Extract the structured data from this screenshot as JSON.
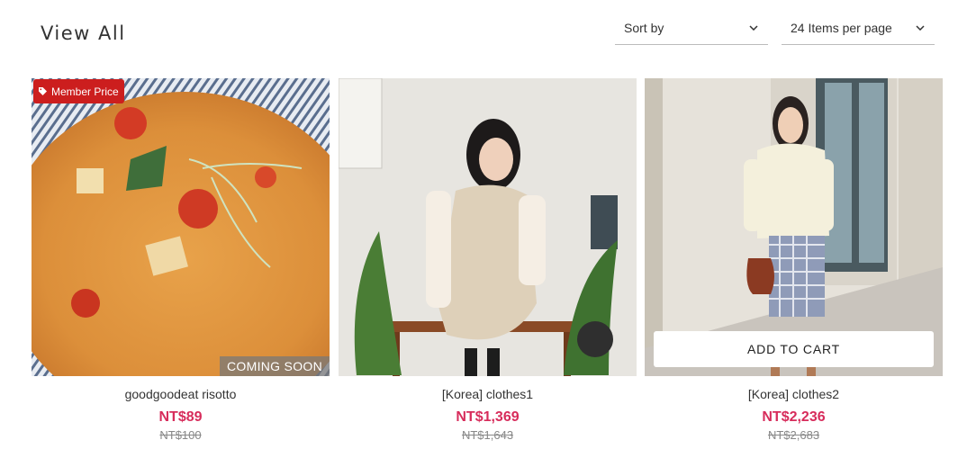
{
  "header": {
    "title": "View All",
    "sort_label": "Sort by",
    "per_page_label": "24 Items per page"
  },
  "products": [
    {
      "name": "goodgoodeat risotto",
      "price": "NT$89",
      "original_price": "NT$100",
      "badge": "Member Price",
      "overlay": "COMING SOON",
      "image_icon": "risotto-photo"
    },
    {
      "name": "[Korea] clothes1",
      "price": "NT$1,369",
      "original_price": "NT$1,643",
      "image_icon": "dress-photo"
    },
    {
      "name": "[Korea] clothes2",
      "price": "NT$2,236",
      "original_price": "NT$2,683",
      "action_label": "ADD TO CART",
      "image_icon": "cardigan-photo"
    }
  ],
  "colors": {
    "price": "#d72c5b",
    "badge": "#cc1e1e"
  }
}
